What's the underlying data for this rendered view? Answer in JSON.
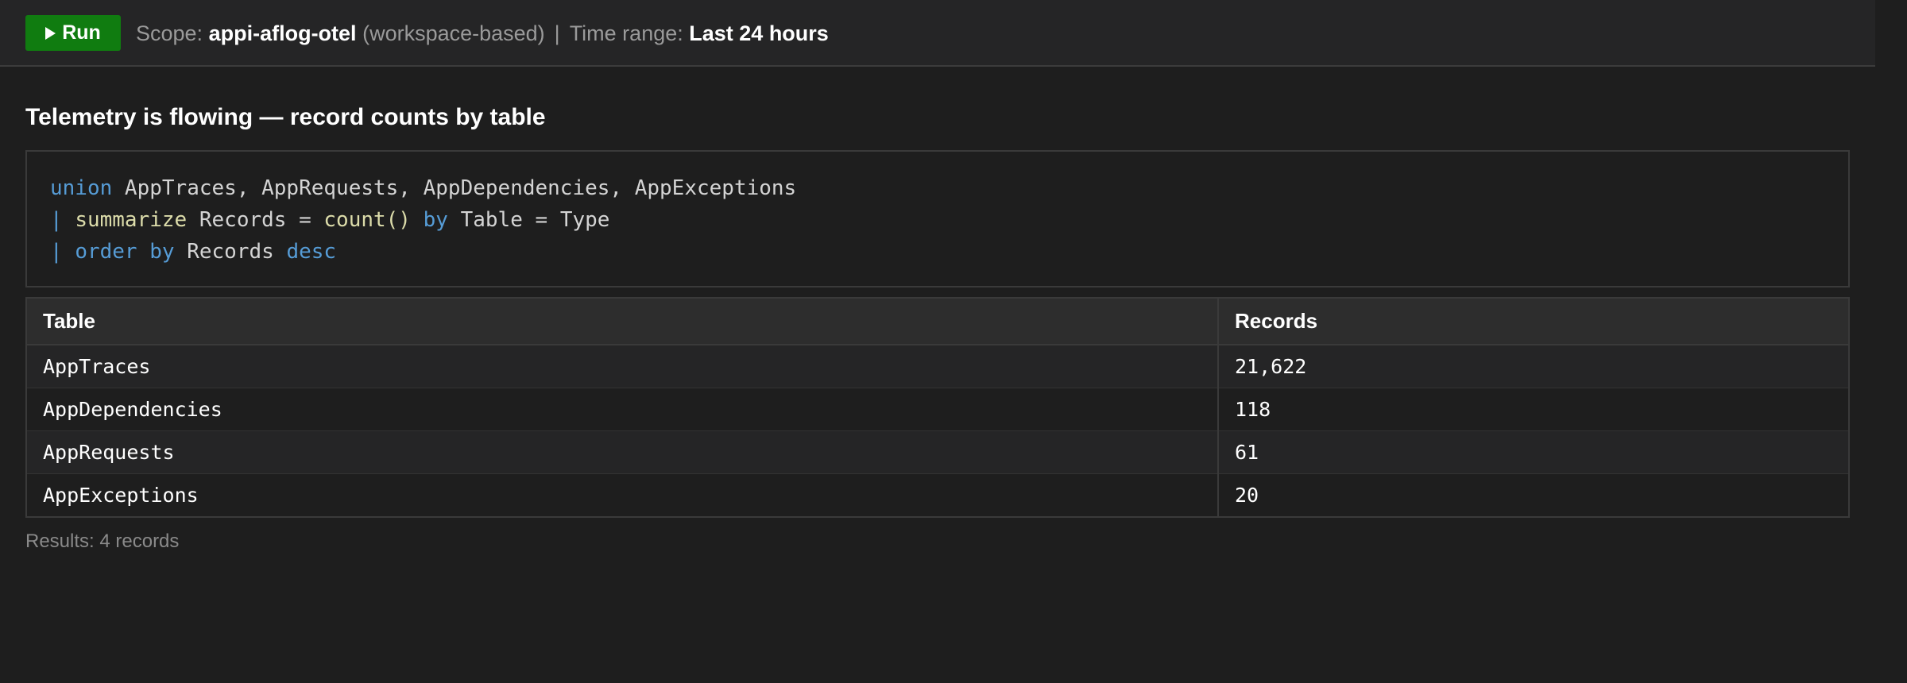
{
  "toolbar": {
    "run_label": "Run",
    "scope_label": "Scope:",
    "scope_value": "appi-aflog-otel",
    "scope_note": "(workspace-based)",
    "separator": "|",
    "time_range_label": "Time range:",
    "time_range_value": "Last 24 hours"
  },
  "heading": "Telemetry is flowing — record counts by table",
  "query": {
    "line1": {
      "kw": "union",
      "rest": " AppTraces, AppRequests, AppDependencies, AppExceptions"
    },
    "line2": {
      "pipe": "|",
      "fn1": "summarize",
      "mid1": " Records = ",
      "fn2": "count()",
      "mid2": " ",
      "kw": "by",
      "rest": " Table = Type"
    },
    "line3": {
      "pipe": "|",
      "kw1": "order by",
      "mid": " Records ",
      "kw2": "desc"
    }
  },
  "table": {
    "columns": [
      "Table",
      "Records"
    ],
    "rows": [
      {
        "table": "AppTraces",
        "records": "21,622"
      },
      {
        "table": "AppDependencies",
        "records": "118"
      },
      {
        "table": "AppRequests",
        "records": "61"
      },
      {
        "table": "AppExceptions",
        "records": "20"
      }
    ]
  },
  "results_text": "Results: 4 records",
  "colors": {
    "run_button": "#107c10",
    "keyword": "#569cd6",
    "function": "#dcdcaa",
    "background": "#1e1e1e"
  }
}
